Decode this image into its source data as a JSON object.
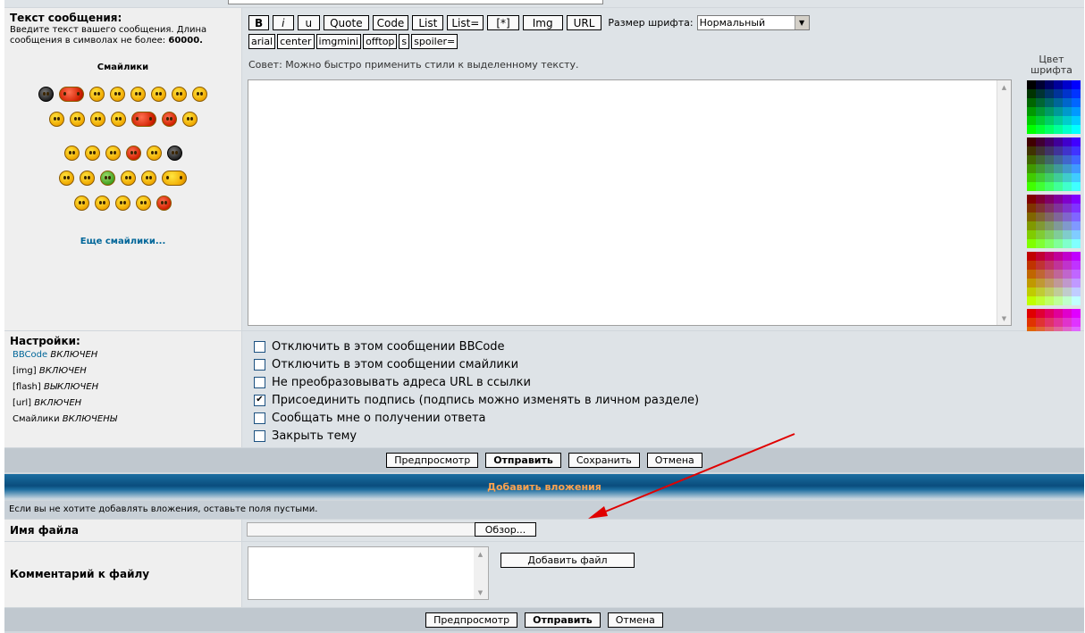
{
  "message": {
    "label": "Текст сообщения:",
    "hint_text": "Введите текст вашего сообщения. Длина сообщения в символах не более:",
    "max_length": "60000.",
    "tip": "Совет: Можно быстро применить стили к выделенному тексту."
  },
  "smilies": {
    "title": "Смайлики",
    "more_link": "Еще смайлики..."
  },
  "toolbar": {
    "row1": [
      "B",
      "i",
      "u",
      "Quote",
      "Code",
      "List",
      "List=",
      "[*]",
      "Img",
      "URL"
    ],
    "row2": [
      "arial",
      "center",
      "imgmini",
      "offtop",
      "s",
      "spoiler="
    ],
    "font_size_label": "Размер шрифта:",
    "font_size_value": "Нормальный"
  },
  "color": {
    "caption_line1": "Цвет",
    "caption_line2": "шрифта"
  },
  "settings": {
    "label": "Настройки:",
    "items": [
      {
        "key": "BBCode",
        "state": "ВКЛЮЧЕН"
      },
      {
        "key": "[img]",
        "state": "ВКЛЮЧЕН"
      },
      {
        "key": "[flash]",
        "state": "ВЫКЛЮЧЕН"
      },
      {
        "key": "[url]",
        "state": "ВКЛЮЧЕН"
      },
      {
        "key": "Смайлики",
        "state": "ВКЛЮЧЕНЫ"
      }
    ],
    "options": [
      {
        "label": "Отключить в этом сообщении BBCode",
        "checked": false
      },
      {
        "label": "Отключить в этом сообщении смайлики",
        "checked": false
      },
      {
        "label": "Не преобразовывать адреса URL в ссылки",
        "checked": false
      },
      {
        "label": "Присоединить подпись (подпись можно изменять в личном разделе)",
        "checked": true
      },
      {
        "label": "Сообщать мне о получении ответа",
        "checked": false
      },
      {
        "label": "Закрыть тему",
        "checked": false
      }
    ]
  },
  "form_buttons": {
    "preview": "Предпросмотр",
    "submit": "Отправить",
    "save": "Сохранить",
    "cancel": "Отмена"
  },
  "attachments": {
    "header": "Добавить вложения",
    "note": "Если вы не хотите добавлять вложения, оставьте поля пустыми.",
    "filename_label": "Имя файла",
    "browse_label": "Обзор...",
    "comment_label": "Комментарий к файлу",
    "add_file_label": "Добавить файл"
  },
  "bottom_buttons": {
    "preview": "Предпросмотр",
    "submit": "Отправить",
    "cancel": "Отмена"
  },
  "colors": {
    "link": "#006699",
    "header_text": "#ffa34f",
    "annotation_arrow": "#e00000"
  }
}
